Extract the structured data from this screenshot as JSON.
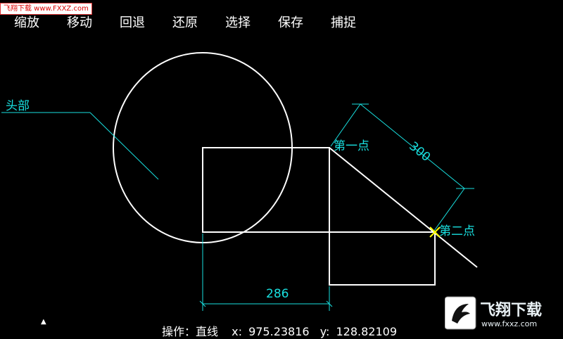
{
  "watermark": {
    "text": "飞翔下载 www.FXXZ.com"
  },
  "toolbar": {
    "zoom": "缩放",
    "move": "移动",
    "undo": "回退",
    "redo": "还原",
    "select": "选择",
    "save": "保存",
    "snap": "捕捉"
  },
  "drawing": {
    "head_label": "头部",
    "point1_label": "第一点",
    "point2_label": "第二点",
    "dim_horizontal": "286",
    "dim_aligned": "300",
    "line_color": "#ffffff",
    "dim_color": "#19e0e0",
    "snap_color": "#ffff00"
  },
  "status": {
    "operation": "操作：直线",
    "x_label": "x:",
    "x_value": "975.23816",
    "y_label": "y:",
    "y_value": "128.82109"
  },
  "logo": {
    "brand": "飞翔下载",
    "url": "www.fxxz.com"
  }
}
